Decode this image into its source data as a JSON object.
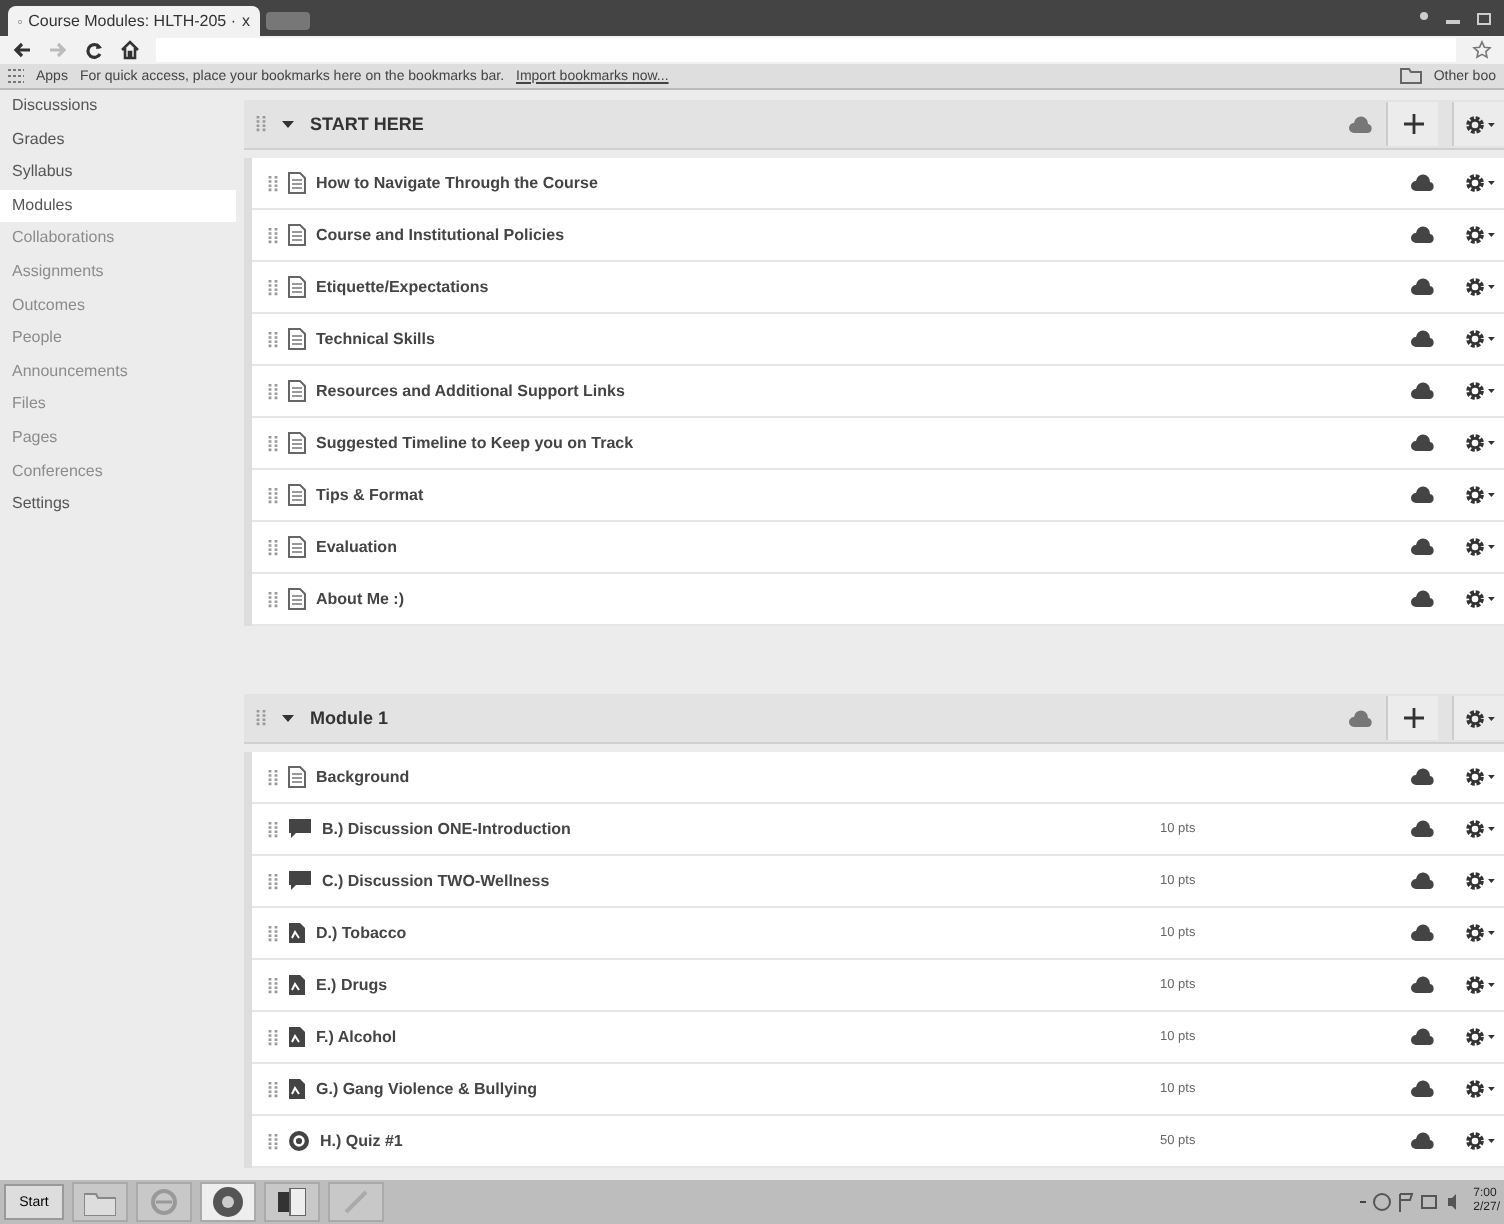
{
  "browser": {
    "tab_title": "Course Modules: HLTH-205 ·",
    "close": "x",
    "apps": "Apps",
    "bookmarks_hint": "For quick access, place your bookmarks here on the bookmarks bar.",
    "import_link": "Import bookmarks now...",
    "other_bookmarks": "Other boo"
  },
  "sidebar": {
    "items": [
      {
        "label": "Discussions",
        "selected": false,
        "disabled": false
      },
      {
        "label": "Grades",
        "selected": false,
        "disabled": false
      },
      {
        "label": "Syllabus",
        "selected": false,
        "disabled": false
      },
      {
        "label": "Modules",
        "selected": true,
        "disabled": false
      },
      {
        "label": "Collaborations",
        "selected": false,
        "disabled": true
      },
      {
        "label": "Assignments",
        "selected": false,
        "disabled": true
      },
      {
        "label": "Outcomes",
        "selected": false,
        "disabled": true
      },
      {
        "label": "People",
        "selected": false,
        "disabled": true
      },
      {
        "label": "Announcements",
        "selected": false,
        "disabled": true
      },
      {
        "label": "Files",
        "selected": false,
        "disabled": true
      },
      {
        "label": "Pages",
        "selected": false,
        "disabled": true
      },
      {
        "label": "Conferences",
        "selected": false,
        "disabled": true
      },
      {
        "label": "Settings",
        "selected": false,
        "disabled": false
      }
    ]
  },
  "modules": [
    {
      "title": "START HERE",
      "expanded": true,
      "items": [
        {
          "kind": "page",
          "title": "How to Navigate Through the Course"
        },
        {
          "kind": "page",
          "title": "Course and Institutional Policies"
        },
        {
          "kind": "page",
          "title": "Etiquette/Expectations"
        },
        {
          "kind": "page",
          "title": "Technical Skills"
        },
        {
          "kind": "page",
          "title": "Resources and Additional Support Links"
        },
        {
          "kind": "page",
          "title": "Suggested Timeline to Keep you on Track"
        },
        {
          "kind": "page",
          "title": "Tips & Format"
        },
        {
          "kind": "page",
          "title": "Evaluation"
        },
        {
          "kind": "page",
          "title": "About Me :)"
        }
      ]
    },
    {
      "title": "Module 1",
      "expanded": true,
      "items": [
        {
          "kind": "page",
          "title": "Background"
        },
        {
          "kind": "discussion",
          "title": "B.) Discussion ONE-Introduction",
          "points": "10 pts"
        },
        {
          "kind": "discussion",
          "title": "C.) Discussion TWO-Wellness",
          "points": "10 pts"
        },
        {
          "kind": "assignment",
          "title": "D.) Tobacco",
          "points": "10 pts"
        },
        {
          "kind": "assignment",
          "title": "E.) Drugs",
          "points": "10 pts"
        },
        {
          "kind": "assignment",
          "title": "F.) Alcohol",
          "points": "10 pts"
        },
        {
          "kind": "assignment",
          "title": "G.) Gang Violence & Bullying",
          "points": "10 pts"
        },
        {
          "kind": "quiz",
          "title": "H.) Quiz #1",
          "points": "50 pts"
        }
      ]
    }
  ],
  "taskbar": {
    "start": "Start",
    "time": "7:00",
    "date": "2/27/"
  }
}
